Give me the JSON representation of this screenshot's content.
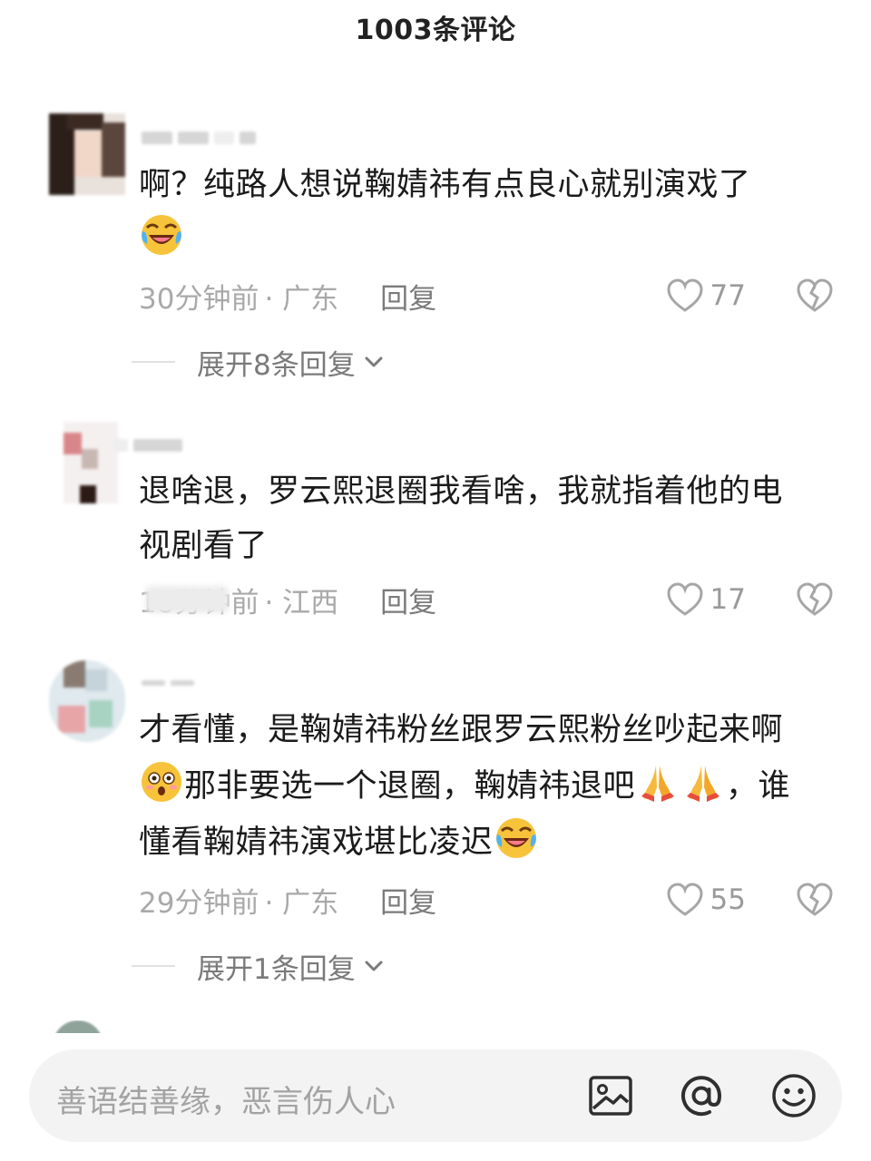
{
  "header": {
    "title": "1003条评论"
  },
  "comments": [
    {
      "text": "啊？纯路人想说鞠婧祎有点良心就别演戏了",
      "time": "30分钟前",
      "location": "· 广东",
      "reply": "回复",
      "likes": "77",
      "expand": "展开8条回复"
    },
    {
      "text_line1": "退啥退，罗云熙退圈我看啥，我就指着他的电",
      "text_line2": "视剧看了",
      "time": "18分钟前",
      "location": "· 江西",
      "reply": "回复",
      "likes": "17"
    },
    {
      "text_line1": "才看懂，是鞠婧祎粉丝跟罗云熙粉丝吵起来啊",
      "text_line2a": "那非要选一个退圈，鞠婧祎退吧",
      "text_line2b": "，谁",
      "text_line3": "懂看鞠婧祎演戏堪比凌迟",
      "time": "29分钟前",
      "location": "· 广东",
      "reply": "回复",
      "likes": "55",
      "expand": "展开1条回复"
    }
  ],
  "input": {
    "placeholder": "善语结善缘，恶言伤人心"
  },
  "icons": {
    "laugh_cry": "face-with-tears-of-joy-icon",
    "flushed": "flushed-face-icon",
    "pray": "folded-hands-icon",
    "like": "heart-outline-icon",
    "dislike": "broken-heart-icon",
    "chevron": "chevron-down-icon",
    "image": "image-icon",
    "mention": "at-sign-icon",
    "emoji": "smiley-icon"
  },
  "colors": {
    "accent_emoji": "#f7c33b",
    "muted_text": "#a9a9a9"
  }
}
